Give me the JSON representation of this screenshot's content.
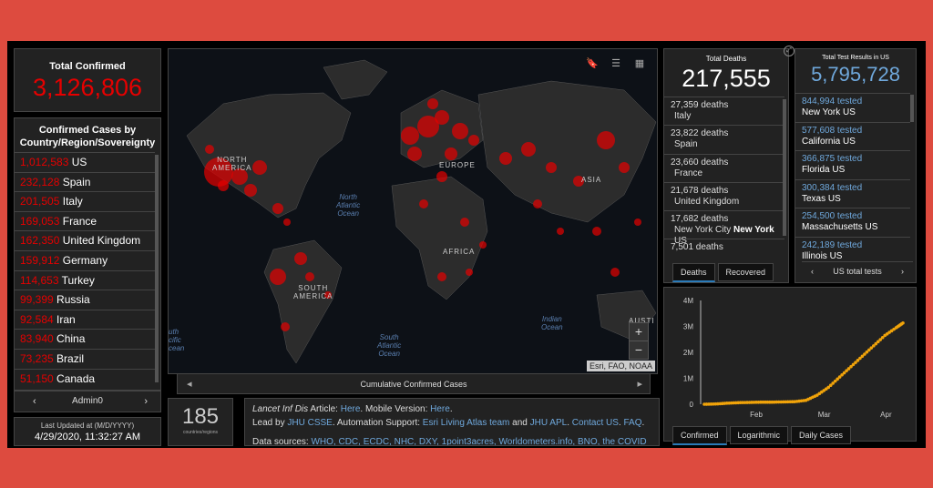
{
  "total_confirmed": {
    "label": "Total Confirmed",
    "value": "3,126,806"
  },
  "country_list": {
    "header": "Confirmed Cases by Country/Region/Sovereignty",
    "rows": [
      {
        "value": "1,012,583",
        "name": "US"
      },
      {
        "value": "232,128",
        "name": "Spain"
      },
      {
        "value": "201,505",
        "name": "Italy"
      },
      {
        "value": "169,053",
        "name": "France"
      },
      {
        "value": "162,350",
        "name": "United Kingdom"
      },
      {
        "value": "159,912",
        "name": "Germany"
      },
      {
        "value": "114,653",
        "name": "Turkey"
      },
      {
        "value": "99,399",
        "name": "Russia"
      },
      {
        "value": "92,584",
        "name": "Iran"
      },
      {
        "value": "83,940",
        "name": "China"
      },
      {
        "value": "73,235",
        "name": "Brazil"
      },
      {
        "value": "51,150",
        "name": "Canada"
      }
    ],
    "admin_label": "Admin0"
  },
  "last_updated": {
    "label": "Last Updated at (M/D/YYYY)",
    "value": "4/29/2020, 11:32:27 AM"
  },
  "map": {
    "labels": {
      "north_america": "NORTH\nAMERICA",
      "europe": "EUROPE",
      "asia": "ASIA",
      "africa": "AFRICA",
      "south_america": "SOUTH\nAMERICA",
      "australia": "AUSTI",
      "north_atlantic": "North\nAtlantic\nOcean",
      "south_atlantic": "South\nAtlantic\nOcean",
      "indian_ocean": "Indian\nOcean",
      "south_pacific": "uth\ncific\ncean"
    },
    "attribution": "Esri, FAO, NOAA",
    "caption": "Cumulative Confirmed Cases",
    "zoom_in": "+",
    "zoom_out": "−"
  },
  "countries_count": {
    "value": "185",
    "label": "countries/regions"
  },
  "info": {
    "article_prefix": "Lancet Inf Dis",
    "article_word": " Article: ",
    "here1": "Here",
    "mobile": ". Mobile Version: ",
    "here2": "Here",
    "led_by": "Lead by ",
    "jhu_csse": "JHU CSSE",
    "automation": ". Automation Support: ",
    "esri": "Esri Living Atlas team",
    "and": " and ",
    "jhu_apl": "JHU APL",
    "contact": "Contact US",
    "faq": "FAQ",
    "data_sources_label": "Data sources: ",
    "data_sources": "WHO, CDC, ECDC, NHC, DXY, 1point3acres, Worldometers.info, BNO, the COVID"
  },
  "deaths": {
    "label": "Total Deaths",
    "value": "217,555",
    "rows": [
      {
        "count": "27,359 deaths",
        "place": "Italy"
      },
      {
        "count": "23,822 deaths",
        "place": "Spain"
      },
      {
        "count": "23,660 deaths",
        "place": "France"
      },
      {
        "count": "21,678 deaths",
        "place": "United Kingdom"
      },
      {
        "count": "17,682 deaths",
        "place": "New York City",
        "bold": "New York",
        "suffix": "US"
      },
      {
        "count": "7,501 deaths",
        "place": ""
      }
    ],
    "tabs": [
      "Deaths",
      "Recovered"
    ]
  },
  "tests": {
    "label": "Total Test Results in US",
    "value": "5,795,728",
    "rows": [
      {
        "count": "844,994 tested",
        "place": "New York US"
      },
      {
        "count": "577,608 tested",
        "place": "California US"
      },
      {
        "count": "366,875 tested",
        "place": "Florida US"
      },
      {
        "count": "300,384 tested",
        "place": "Texas US"
      },
      {
        "count": "254,500 tested",
        "place": "Massachusetts US"
      },
      {
        "count": "242,189 tested",
        "place": "Illinois US"
      }
    ],
    "footer": "US total tests"
  },
  "chart_tabs": [
    "Confirmed",
    "Logarithmic",
    "Daily Cases"
  ],
  "chart_data": {
    "type": "scatter",
    "x_ticks": [
      "Feb",
      "Mar",
      "Apr"
    ],
    "y_ticks": [
      "0",
      "1M",
      "2M",
      "3M",
      "4M"
    ],
    "ylim": [
      0,
      4000000
    ],
    "series": [
      {
        "color": "#f0a30a",
        "points": [
          [
            0,
            0.0
          ],
          [
            5,
            0.01
          ],
          [
            10,
            0.04
          ],
          [
            15,
            0.06
          ],
          [
            20,
            0.07
          ],
          [
            25,
            0.08
          ],
          [
            30,
            0.08
          ],
          [
            35,
            0.09
          ],
          [
            40,
            0.1
          ],
          [
            45,
            0.15
          ],
          [
            50,
            0.35
          ],
          [
            55,
            0.65
          ],
          [
            60,
            1.05
          ],
          [
            65,
            1.45
          ],
          [
            70,
            1.85
          ],
          [
            75,
            2.25
          ],
          [
            80,
            2.65
          ],
          [
            85,
            2.95
          ],
          [
            88,
            3.13
          ]
        ]
      }
    ]
  },
  "colors": {
    "confirmed": "#e60000",
    "tested": "#6fa8dc",
    "curve": "#f0a30a",
    "bg": "#dd4b3f"
  }
}
